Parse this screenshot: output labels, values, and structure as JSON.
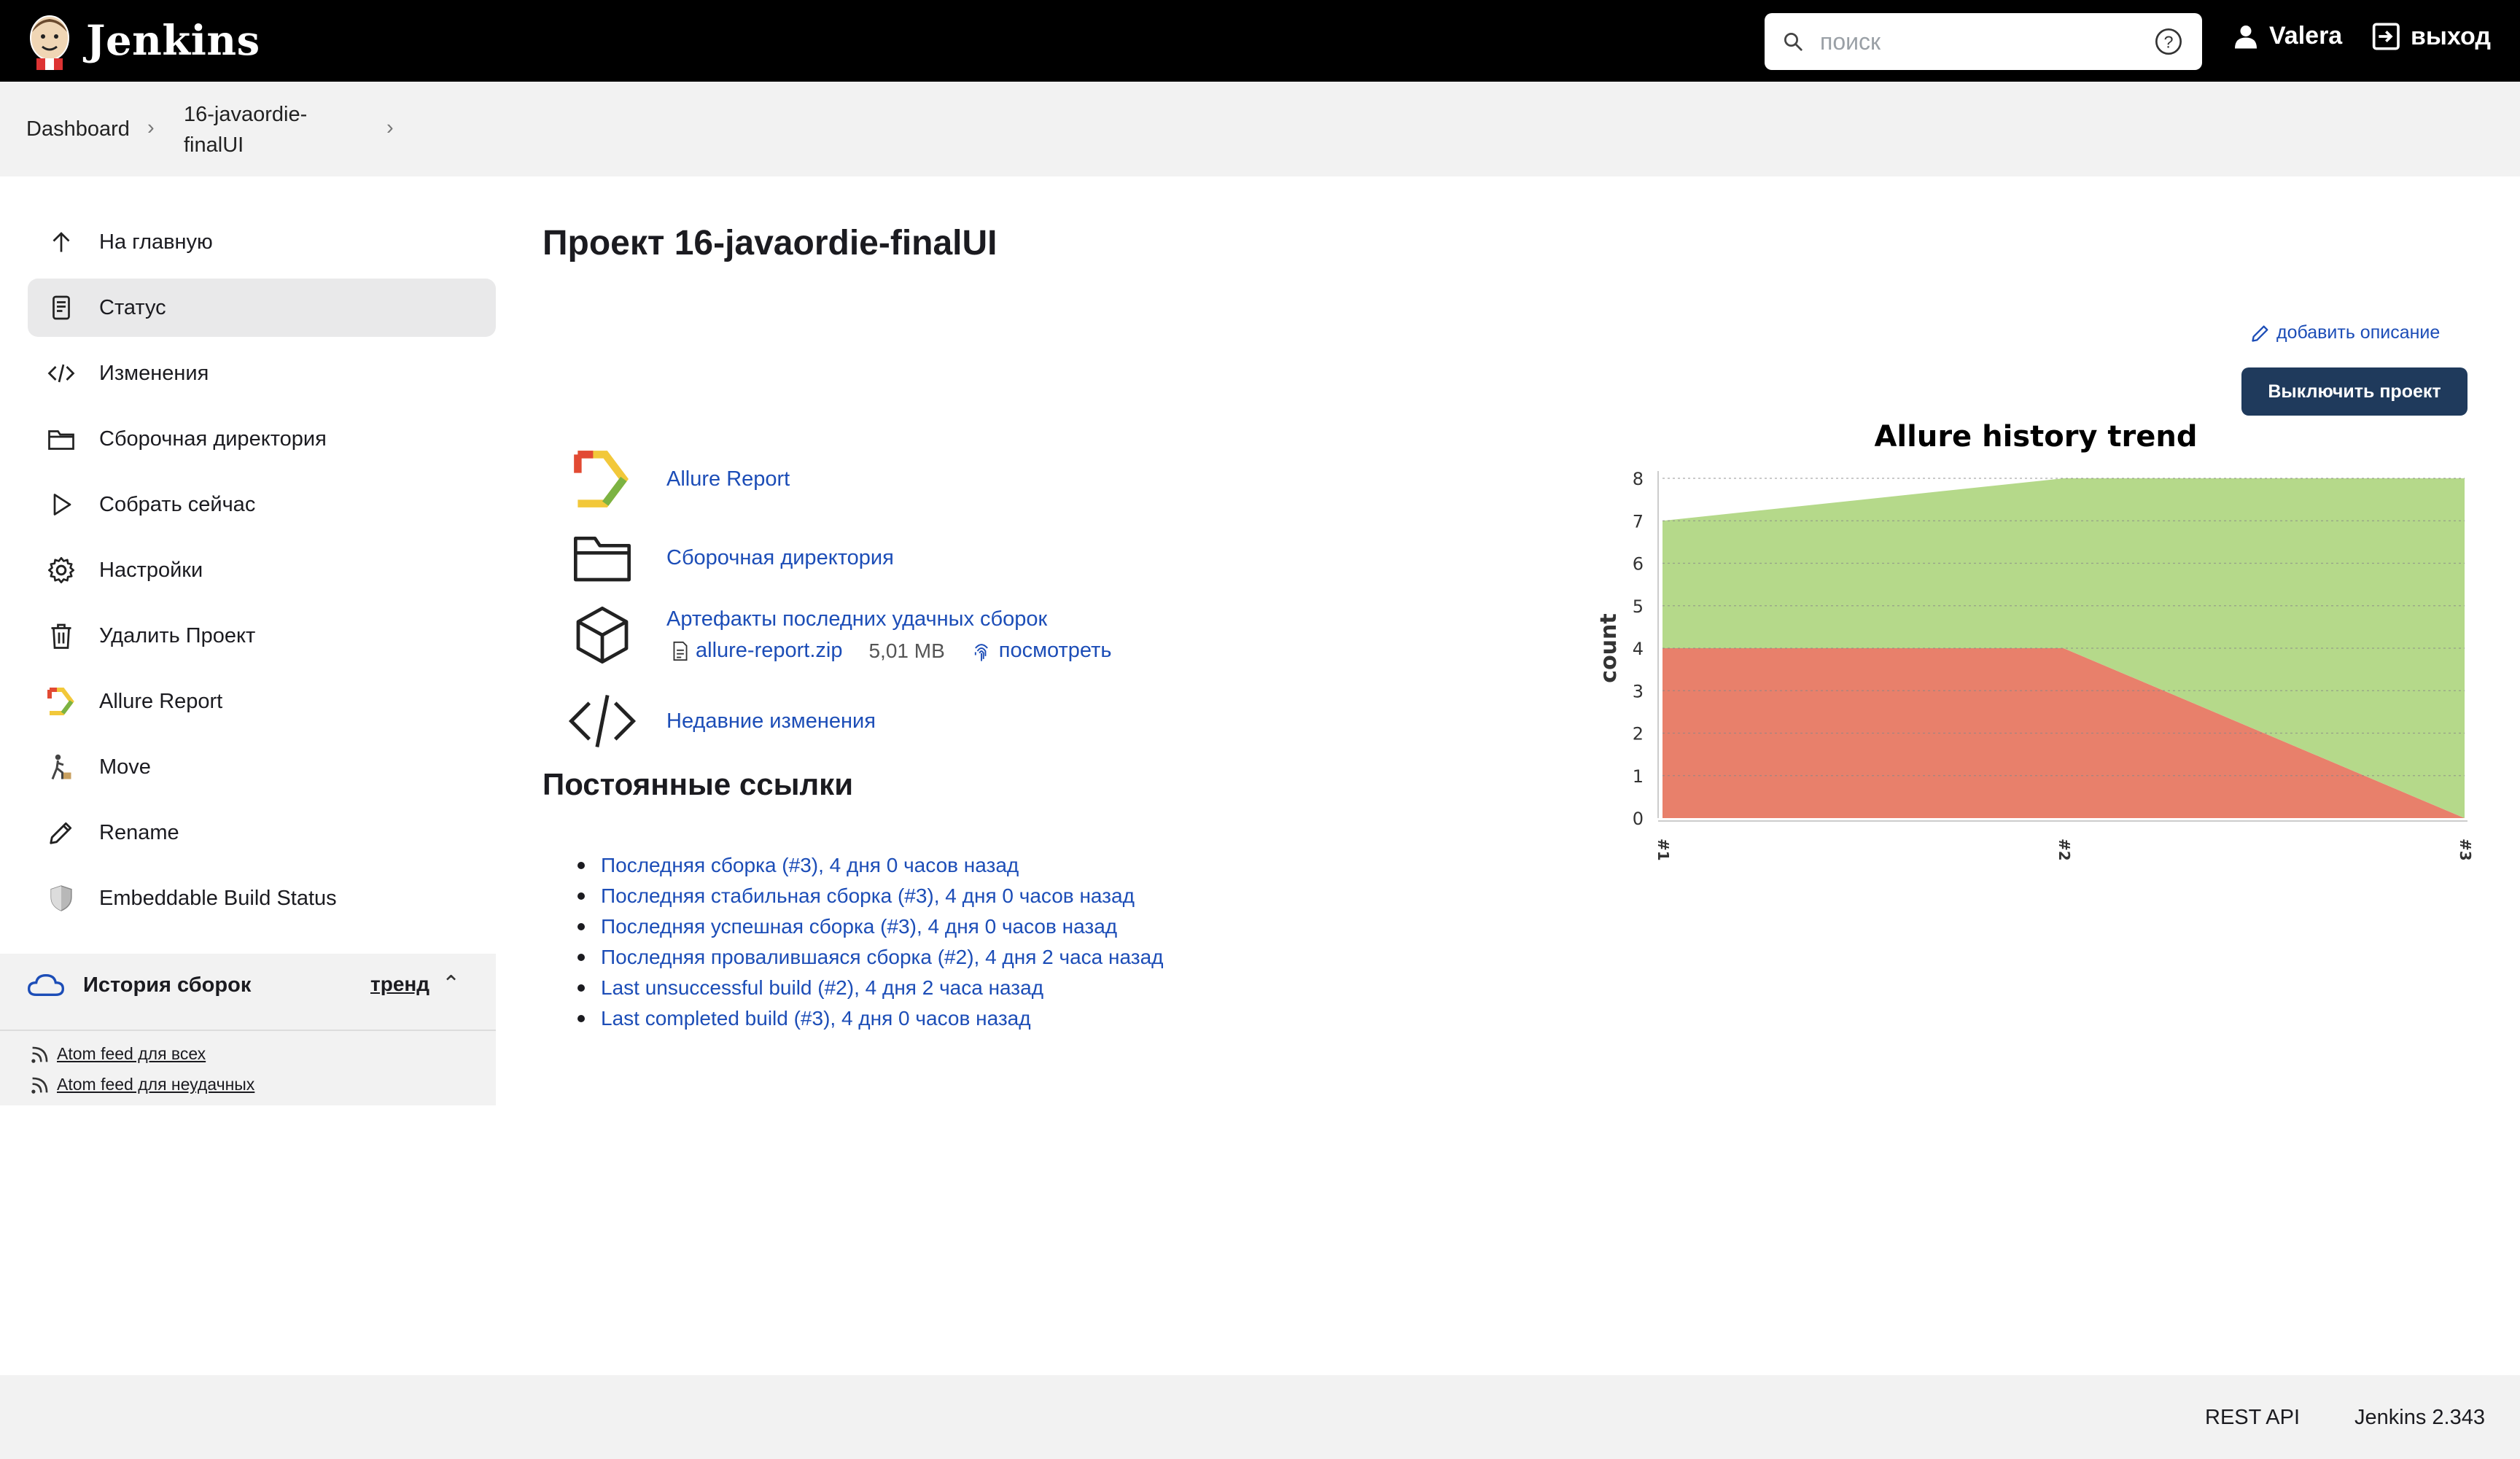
{
  "header": {
    "logo_text": "Jenkins",
    "search_placeholder": "поиск",
    "user": "Valera",
    "logout": "выход"
  },
  "breadcrumbs": {
    "dashboard": "Dashboard",
    "project_line1": "16-javaordie-",
    "project_line2": "finalUI"
  },
  "sidebar": {
    "items": [
      {
        "label": "На главную",
        "icon": "arrow-up-icon"
      },
      {
        "label": "Статус",
        "icon": "document-icon"
      },
      {
        "label": "Изменения",
        "icon": "code-icon"
      },
      {
        "label": "Сборочная директория",
        "icon": "folder-icon"
      },
      {
        "label": "Собрать сейчас",
        "icon": "play-icon"
      },
      {
        "label": "Настройки",
        "icon": "gear-icon"
      },
      {
        "label": "Удалить Проект",
        "icon": "trash-icon"
      },
      {
        "label": "Allure Report",
        "icon": "allure-icon"
      },
      {
        "label": "Move",
        "icon": "move-icon"
      },
      {
        "label": "Rename",
        "icon": "pencil-icon"
      },
      {
        "label": "Embeddable Build Status",
        "icon": "shield-icon"
      }
    ],
    "history": {
      "title": "История сборок",
      "trend": "тренд",
      "feed_all": "Atom feed для всех",
      "feed_failed": "Atom feed для неудачных"
    }
  },
  "main": {
    "title": "Проект 16-javaordie-finalUI",
    "add_description": "добавить описание",
    "disable_button": "Выключить проект",
    "allure_report": "Allure Report",
    "workspace": "Сборочная директория",
    "artifacts_title": "Артефакты последних удачных сборок",
    "artifact_file": "allure-report.zip",
    "artifact_size": "5,01 MB",
    "artifact_view": "посмотреть",
    "recent_changes": "Недавние изменения",
    "permalinks_title": "Постоянные ссылки",
    "permalinks": [
      "Последняя сборка (#3), 4 дня 0 часов назад",
      "Последняя стабильная сборка (#3), 4 дня 0 часов назад",
      "Последняя успешная сборка (#3), 4 дня 0 часов назад",
      "Последняя провалившаяся сборка (#2), 4 дня 2 часа назад",
      "Last unsuccessful build (#2), 4 дня 2 часа назад",
      "Last completed build (#3), 4 дня 0 часов назад"
    ]
  },
  "chart_data": {
    "type": "area",
    "title": "Allure history trend",
    "xlabel": "",
    "ylabel": "count",
    "categories": [
      "#1",
      "#2",
      "#3"
    ],
    "series": [
      {
        "values": [
          4,
          4,
          0
        ],
        "color": "#e8806b"
      },
      {
        "values": [
          3,
          4,
          8
        ],
        "color": "#b5d98a"
      }
    ],
    "ylim": [
      0,
      8
    ],
    "yticks": [
      0,
      1,
      2,
      3,
      4,
      5,
      6,
      7,
      8
    ],
    "stacked": true,
    "grid": true
  },
  "footer": {
    "rest_api": "REST API",
    "version": "Jenkins 2.343"
  }
}
